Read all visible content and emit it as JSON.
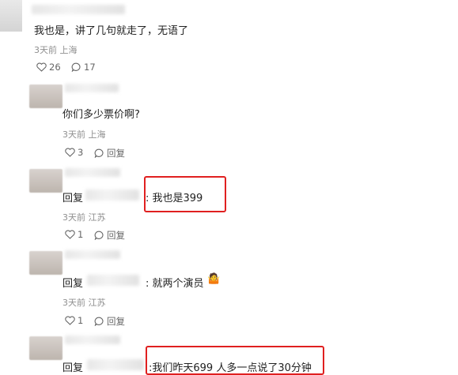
{
  "comments": [
    {
      "text": "我也是，讲了几句就走了，无语了",
      "meta": "3天前 上海",
      "likes": "26",
      "replies": "17"
    },
    {
      "author_partial": "丁 翮木瓜",
      "text": "你们多少票价啊?",
      "meta": "3天前 上海",
      "likes": "3",
      "reply_label": "回复"
    },
    {
      "reply_prefix": "回复",
      "text": ": 我也是399",
      "meta": "3天前 江苏",
      "likes": "1",
      "reply_label": "回复"
    },
    {
      "reply_prefix": "回复",
      "text": ": 就两个演员",
      "emoji": "🤷",
      "meta": "3天前 江苏",
      "likes": "1",
      "reply_label": "回复"
    },
    {
      "reply_prefix": "回复",
      "text": ":我们昨天699 人多一点说了30分钟"
    }
  ],
  "colors": {
    "highlight": "#e02020",
    "meta": "#8f8f8f"
  }
}
